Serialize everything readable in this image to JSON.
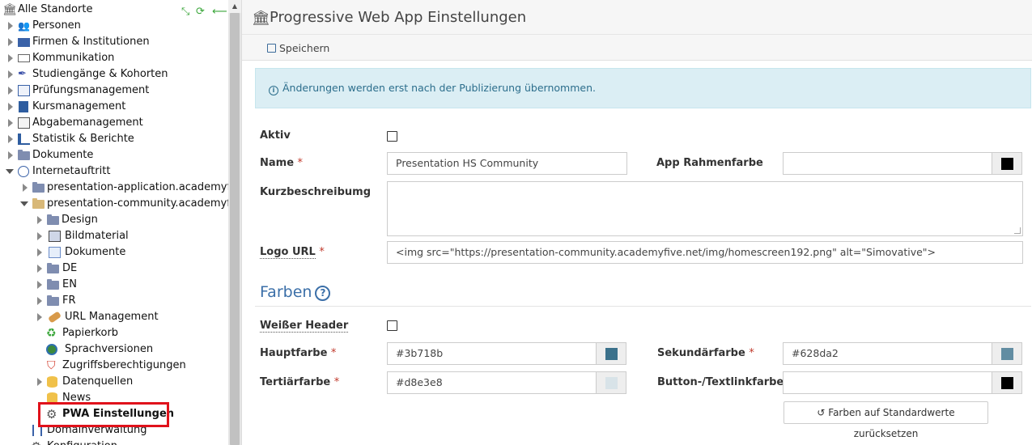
{
  "sidebar": {
    "root": "Alle Standorte",
    "items": [
      {
        "label": "Personen"
      },
      {
        "label": "Firmen & Institutionen"
      },
      {
        "label": "Kommunikation"
      },
      {
        "label": "Studiengänge & Kohorten"
      },
      {
        "label": "Prüfungsmanagement"
      },
      {
        "label": "Kursmanagement"
      },
      {
        "label": "Abgabemanagement"
      },
      {
        "label": "Statistik & Berichte"
      },
      {
        "label": "Dokumente"
      },
      {
        "label": "Internetauftritt"
      },
      {
        "label": "presentation-application.academyfive"
      },
      {
        "label": "presentation-community.academyfive"
      },
      {
        "label": "Design"
      },
      {
        "label": "Bildmaterial"
      },
      {
        "label": "Dokumente"
      },
      {
        "label": "DE"
      },
      {
        "label": "EN"
      },
      {
        "label": "FR"
      },
      {
        "label": "URL Management"
      },
      {
        "label": "Papierkorb"
      },
      {
        "label": "Sprachversionen"
      },
      {
        "label": "Zugriffsberechtigungen"
      },
      {
        "label": "Datenquellen"
      },
      {
        "label": "News"
      },
      {
        "label": "PWA Einstellungen"
      },
      {
        "label": "Domainverwaltung"
      },
      {
        "label": "Konfiguration"
      }
    ]
  },
  "page": {
    "title": "Progressive Web App Einstellungen",
    "save_label": "Speichern",
    "info": "Änderungen werden erst nach der Publizierung übernommen."
  },
  "form": {
    "active_label": "Aktiv",
    "name_label": "Name",
    "name_value": "Presentation HS Community",
    "frame_color_label": "App Rahmenfarbe",
    "frame_color_value": "",
    "short_desc_label": "Kurzbeschreibumg",
    "logo_label": "Logo URL",
    "logo_value": "<img src=\"https://presentation-community.academyfive.net/img/homescreen192.png\" alt=\"Simovative\">",
    "required_mark": "*"
  },
  "colors": {
    "heading": "Farben",
    "white_header_label": "Weißer Header",
    "primary_label": "Hauptfarbe",
    "primary_value": "#3b718b",
    "secondary_label": "Sekundärfarbe",
    "secondary_value": "#628da2",
    "tertiary_label": "Tertiärfarbe",
    "tertiary_value": "#d8e3e8",
    "button_label": "Button-/Textlinkfarbe",
    "button_value": "",
    "reset_label": "Farben auf Standardwerte zurücksetzen",
    "frame_swatch": "#000000",
    "button_swatch": "#000000"
  },
  "theme": {
    "accent": "#3b6fa8",
    "info_bg": "#dbeef4",
    "highlight": "#e0121b"
  }
}
